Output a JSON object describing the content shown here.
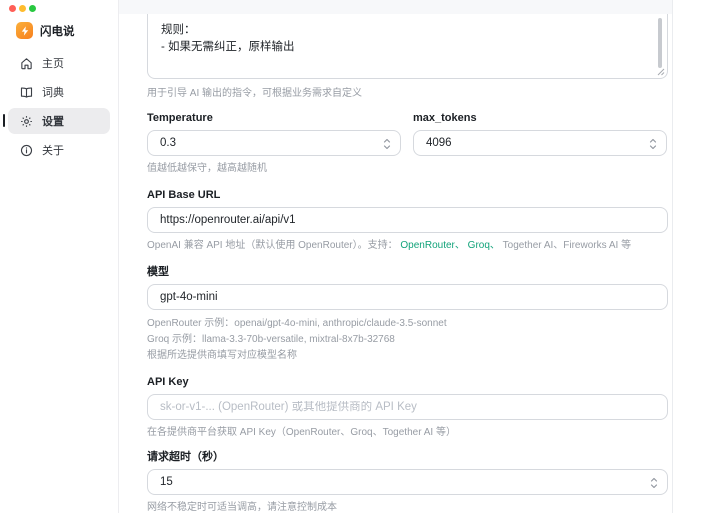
{
  "window": {
    "traffic_lights": [
      "close",
      "minimize",
      "zoom"
    ]
  },
  "sidebar": {
    "app_name": "闪电说",
    "items": [
      {
        "label": "主页",
        "icon": "home-icon",
        "selected": false
      },
      {
        "label": "词典",
        "icon": "book-icon",
        "selected": false
      },
      {
        "label": "设置",
        "icon": "gear-icon",
        "selected": true
      },
      {
        "label": "关于",
        "icon": "info-icon",
        "selected": false
      }
    ]
  },
  "form": {
    "prompt": {
      "line1": "规则：",
      "line2": "- 如果无需纠正，原样输出",
      "helper": "用于引导 AI 输出的指令，可根据业务需求自定义"
    },
    "temperature": {
      "label": "Temperature",
      "value": "0.3",
      "helper": "值越低越保守，越高越随机"
    },
    "max_tokens": {
      "label": "max_tokens",
      "value": "4096"
    },
    "api_base_url": {
      "label": "API Base URL",
      "value": "https://openrouter.ai/api/v1",
      "helper_prefix": "OpenAI 兼容 API 地址（默认使用 OpenRouter）。支持： ",
      "helper_link1": "OpenRouter、",
      "helper_mid": " ",
      "helper_link2": "Groq、",
      "helper_suffix": " Together AI、Fireworks AI 等"
    },
    "model": {
      "label": "模型",
      "value": "gpt-4o-mini",
      "helpers": [
        "OpenRouter 示例：openai/gpt-4o-mini, anthropic/claude-3.5-sonnet",
        "Groq 示例：llama-3.3-70b-versatile, mixtral-8x7b-32768",
        "根据所选提供商填写对应模型名称"
      ]
    },
    "api_key": {
      "label": "API Key",
      "placeholder": "sk-or-v1-... (OpenRouter) 或其他提供商的 API Key",
      "helper": "在各提供商平台获取 API Key（OpenRouter、Groq、Together AI 等）"
    },
    "timeout": {
      "label": "请求超时（秒）",
      "value": "15",
      "helper": "网络不稳定时可适当调高，请注意控制成本"
    }
  },
  "colors": {
    "accent_green": "#12a37a",
    "selected_bg": "#ececee",
    "border": "#d6d9de"
  }
}
